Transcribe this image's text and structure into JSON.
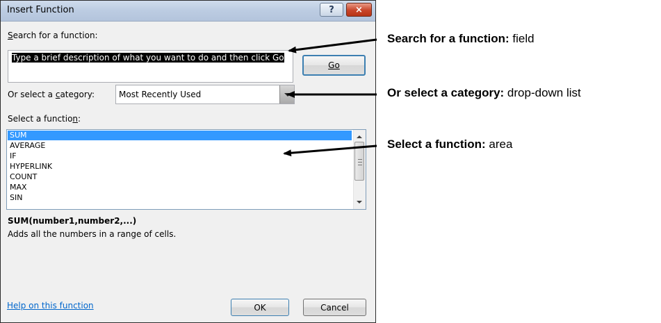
{
  "dialog": {
    "title": "Insert Function",
    "help_button": "?",
    "close_button": "×",
    "search_label_pre": "",
    "search_label_key": "S",
    "search_label_post": "earch for a function:",
    "search_value": "Type a brief description of what you want to do and then click Go",
    "go_button": "Go",
    "category_label_pre": "Or select a ",
    "category_label_key": "c",
    "category_label_post": "ategory:",
    "category_value": "Most Recently Used",
    "function_label_pre": "Select a functio",
    "function_label_key": "n",
    "function_label_post": ":",
    "functions": [
      {
        "name": "SUM",
        "selected": true
      },
      {
        "name": "AVERAGE",
        "selected": false
      },
      {
        "name": "IF",
        "selected": false
      },
      {
        "name": "HYPERLINK",
        "selected": false
      },
      {
        "name": "COUNT",
        "selected": false
      },
      {
        "name": "MAX",
        "selected": false
      },
      {
        "name": "SIN",
        "selected": false
      }
    ],
    "syntax": "SUM(number1,number2,...)",
    "description": "Adds all the numbers in a range of cells.",
    "help_link": "Help on this function",
    "ok_button": "OK",
    "cancel_button": "Cancel"
  },
  "annotations": [
    {
      "bold": "Search for a function:",
      "rest": " field"
    },
    {
      "bold": "Or select a category:",
      "rest": " drop-down list"
    },
    {
      "bold": "Select a function:",
      "rest": " area"
    }
  ],
  "colors": {
    "selection": "#3399ff",
    "link": "#0066cc",
    "titlebar": "#bccce2",
    "close_button": "#c8452a"
  }
}
